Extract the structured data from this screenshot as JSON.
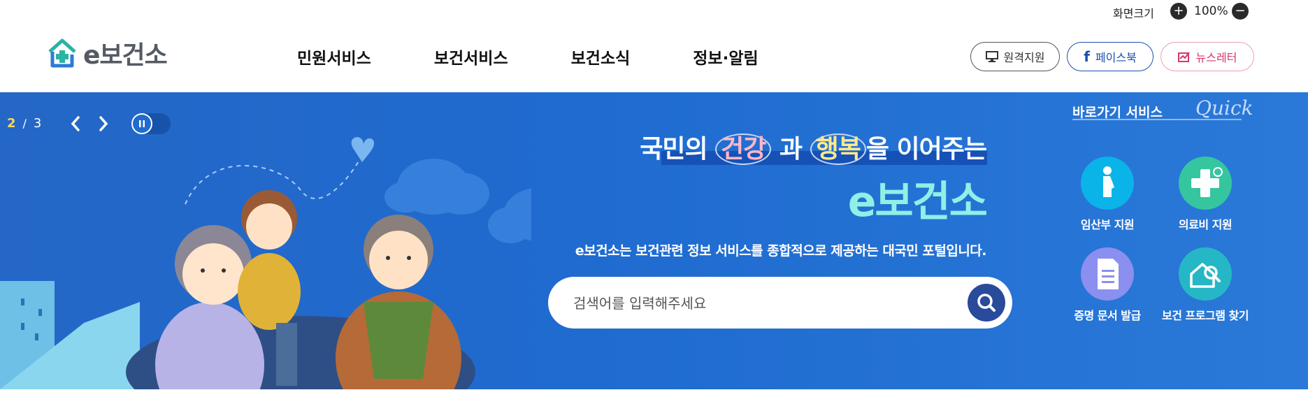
{
  "topbar": {
    "zoom_label": "화면크기",
    "zoom_value": "100%"
  },
  "header": {
    "logo_text": "e보건소",
    "nav": [
      "민원서비스",
      "보건서비스",
      "보건소식",
      "정보·알림"
    ],
    "links": [
      {
        "label": "원격지원",
        "color": "#333333"
      },
      {
        "label": "페이스북",
        "color": "#1d4fb0"
      },
      {
        "label": "뉴스레터",
        "color": "#d9356f"
      }
    ]
  },
  "hero": {
    "slide_current": "2",
    "slide_separator": "/",
    "slide_total": "3",
    "headline_parts": [
      "국민의 ",
      "건강",
      " 과 ",
      "행복",
      "을 이어주는"
    ],
    "brand": "e보건소",
    "description": "e보건소는 보건관련 정보 서비스를 종합적으로 제공하는 대국민 포털입니다.",
    "search_placeholder": "검색어를 입력해주세요"
  },
  "quick": {
    "title": "바로가기 서비스",
    "script": "Quick",
    "items": [
      {
        "label": "임산부 지원",
        "icon": "pregnant-woman-icon",
        "color": "#0ab4e8"
      },
      {
        "label": "의료비 지원",
        "icon": "medical-cross-icon",
        "color": "#35c6a0"
      },
      {
        "label": "증명 문서 발급",
        "icon": "document-icon",
        "color": "#8a8ff0"
      },
      {
        "label": "보건 프로그램 찾기",
        "icon": "house-search-icon",
        "color": "#26b7c6"
      }
    ]
  },
  "colors": {
    "hero_blue": "#1f6bd0",
    "accent_yellow": "#ffd65a",
    "brand_mint": "#8ff0e6",
    "search_button": "#2a4a9c"
  }
}
